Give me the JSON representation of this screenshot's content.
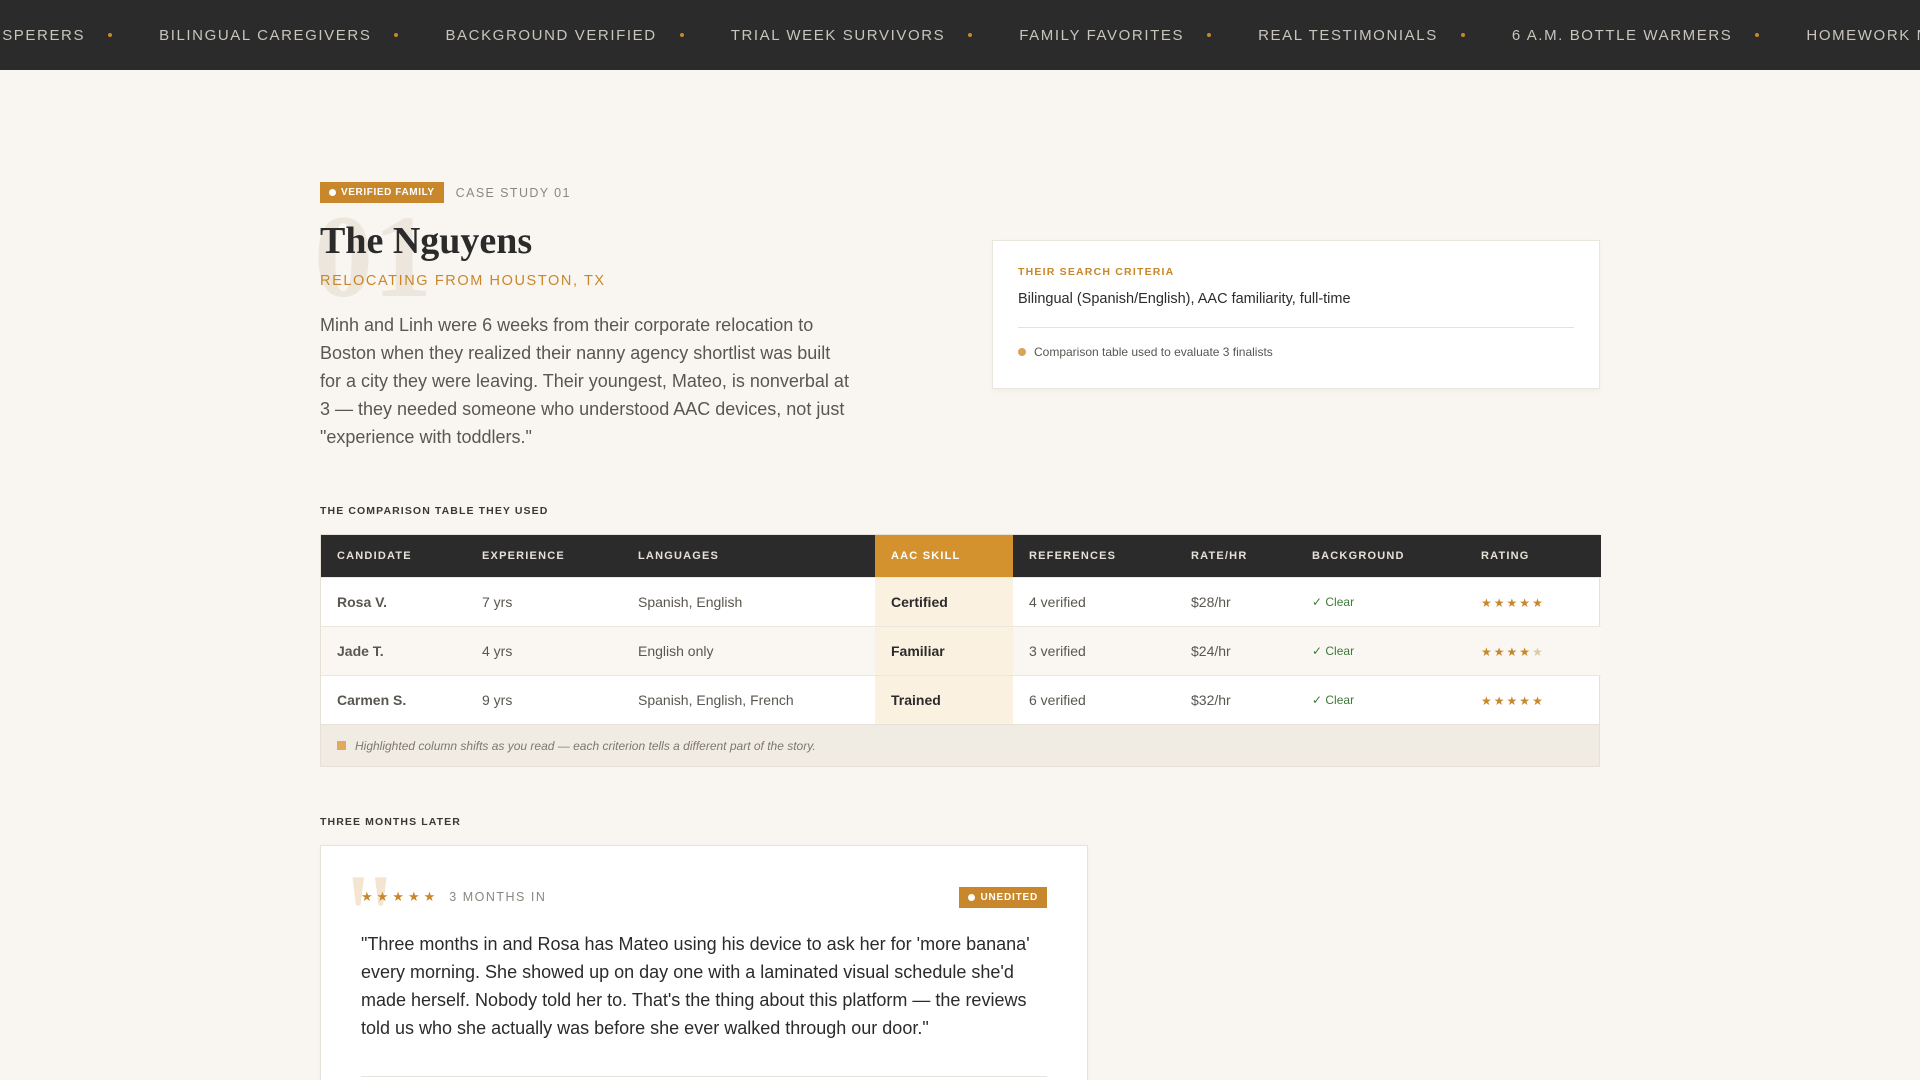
{
  "marquee": {
    "items": [
      "HISPERERS",
      "BILINGUAL CAREGIVERS",
      "BACKGROUND VERIFIED",
      "TRIAL WEEK SURVIVORS",
      "FAMILY FAVORITES",
      "REAL TESTIMONIALS",
      "6 A.M. BOTTLE WARMERS",
      "HOMEWORK NEGOTIATO"
    ]
  },
  "case": {
    "badge": "VERIFIED FAMILY",
    "label": "CASE STUDY 01",
    "ghost_number": "01",
    "family_name": "The Nguyens",
    "relocating": "RELOCATING FROM HOUSTON, TX",
    "story": "Minh and Linh were 6 weeks from their corporate relocation to Boston when they realized their nanny agency shortlist was built for a city they were leaving. Their youngest, Mateo, is nonverbal at 3 — they needed someone who understood AAC devices, not just \"experience with toddlers.\""
  },
  "criteria": {
    "title": "THEIR SEARCH CRITERIA",
    "text": "Bilingual (Spanish/English), AAC familiarity, full-time",
    "note": "Comparison table used to evaluate 3 finalists"
  },
  "table_section": {
    "label": "THE COMPARISON TABLE THEY USED",
    "columns": [
      "CANDIDATE",
      "EXPERIENCE",
      "LANGUAGES",
      "AAC SKILL",
      "REFERENCES",
      "RATE/HR",
      "BACKGROUND",
      "RATING"
    ],
    "rows": [
      {
        "candidate": "Rosa V.",
        "experience": "7 yrs",
        "languages": "Spanish, English",
        "aac": "Certified",
        "references": "4 verified",
        "rate": "$28/hr",
        "background": "✓ Clear",
        "rating": 5
      },
      {
        "candidate": "Jade T.",
        "experience": "4 yrs",
        "languages": "English only",
        "aac": "Familiar",
        "references": "3 verified",
        "rate": "$24/hr",
        "background": "✓ Clear",
        "rating": 4
      },
      {
        "candidate": "Carmen S.",
        "experience": "9 yrs",
        "languages": "Spanish, English, French",
        "aac": "Trained",
        "references": "6 verified",
        "rate": "$32/hr",
        "background": "✓ Clear",
        "rating": 5
      }
    ],
    "note": "Highlighted column shifts as you read — each criterion tells a different part of the story."
  },
  "testimonial_section": {
    "label": "THREE MONTHS LATER",
    "stars": "★★★★★",
    "when": "3 MONTHS IN",
    "badge": "UNEDITED",
    "quote": "\"Three months in and Rosa has Mateo using his device to ask her for 'more banana' every morning. She showed up on day one with a laminated visual schedule she'd made herself. Nobody told her to. That's the thing about this platform — the reviews told us who she actually was before she ever walked through our door.\""
  },
  "colors": {
    "accent": "#c8872a",
    "dark": "#2b2b2b",
    "background": "#f9f6f1",
    "highlight_column": "#d4922f",
    "clear_green": "#3d7a3a"
  }
}
